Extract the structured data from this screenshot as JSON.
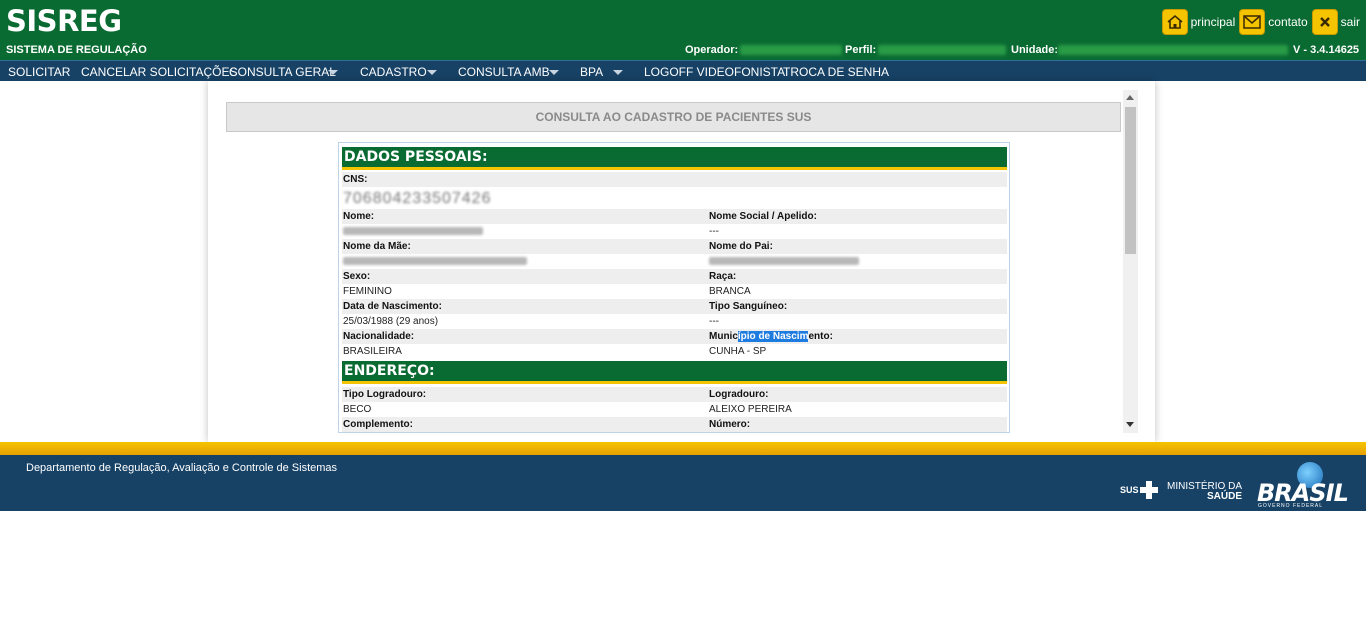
{
  "header": {
    "logo": "SISREG",
    "subtitle": "SISTEMA DE REGULAÇÃO",
    "links": [
      {
        "icon": "home-icon",
        "label": "principal"
      },
      {
        "icon": "mail-icon",
        "label": "contato"
      },
      {
        "icon": "close-icon",
        "label": "sair"
      }
    ],
    "operador_label": "Operador:",
    "perfil_label": "Perfil:",
    "unidade_label": "Unidade:",
    "version": "V - 3.4.14625"
  },
  "nav": [
    {
      "label": "SOLICITAR",
      "dropdown": false
    },
    {
      "label": "CANCELAR SOLICITAÇÕES",
      "dropdown": false
    },
    {
      "label": "CONSULTA GERAL",
      "dropdown": true
    },
    {
      "label": "CADASTRO",
      "dropdown": true
    },
    {
      "label": "CONSULTA AMB",
      "dropdown": true
    },
    {
      "label": "BPA",
      "dropdown": true
    },
    {
      "label": "LOGOFF VIDEOFONISTA",
      "dropdown": false
    },
    {
      "label": "TROCA DE SENHA",
      "dropdown": false
    }
  ],
  "page": {
    "title": "CONSULTA AO CADASTRO DE PACIENTES SUS",
    "sections": {
      "personal": "DADOS PESSOAIS:",
      "address": "ENDEREÇO:"
    },
    "fields": {
      "cns_label": "CNS:",
      "nome_label": "Nome:",
      "nome_social_label": "Nome Social / Apelido:",
      "nome_social_value": "---",
      "nome_mae_label": "Nome da Mãe:",
      "nome_pai_label": "Nome do Pai:",
      "sexo_label": "Sexo:",
      "sexo_value": "FEMININO",
      "raca_label": "Raça:",
      "raca_value": "BRANCA",
      "nasc_label": "Data de Nascimento:",
      "nasc_value": "25/03/1988 (29 anos)",
      "sangue_label": "Tipo Sanguíneo:",
      "sangue_value": "---",
      "nacionalidade_label": "Nacionalidade:",
      "nacionalidade_value": "BRASILEIRA",
      "municipio_label_a": "Munic",
      "municipio_label_sel": "ípio de Nascim",
      "municipio_label_b": "ento:",
      "municipio_value": "CUNHA - SP",
      "tipo_logradouro_label": "Tipo Logradouro:",
      "tipo_logradouro_value": "BECO",
      "logradouro_label": "Logradouro:",
      "logradouro_value": "ALEIXO PEREIRA",
      "complemento_label": "Complemento:",
      "numero_label": "Número:"
    }
  },
  "footer": {
    "text": "Departamento de Regulação, Avaliação e Controle de Sistemas",
    "sus": "SUS",
    "ministerio_line1": "MINISTÉRIO DA",
    "ministerio_line2": "SAÚDE",
    "brasil": "BRASIL",
    "brasil_sub": "GOVERNO FEDERAL"
  },
  "colors": {
    "header_green": "#0a6b32",
    "nav_blue": "#174266",
    "accent_yellow": "#f5c400",
    "selection_blue": "#1e7be0"
  }
}
